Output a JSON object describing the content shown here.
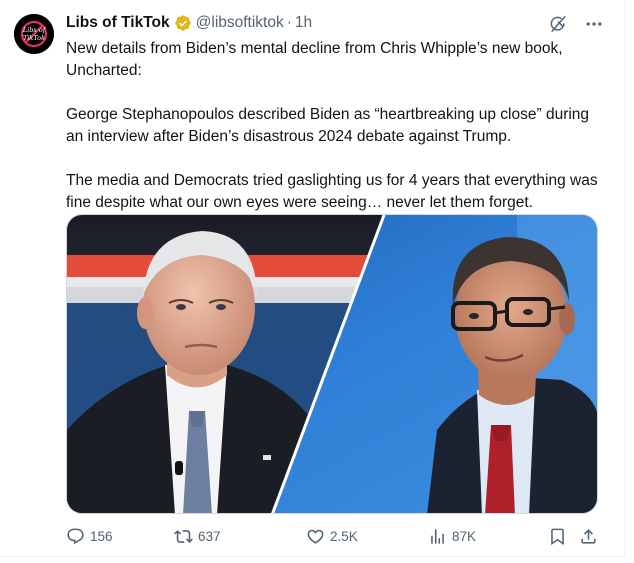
{
  "author": {
    "display_name": "Libs of TikTok",
    "handle": "@libsoftiktok",
    "separator": "·",
    "time": "1h",
    "avatar_text_top": "Libs of",
    "avatar_text_bottom": "TikTok"
  },
  "tweet": {
    "paragraphs": [
      "New details from Biden’s mental decline from Chris Whipple’s new book, Uncharted:",
      "George Stephanopoulos described Biden as “heartbreaking up close” during an interview after Biden’s disastrous 2024 debate against Trump.",
      "The media and Democrats tried gaslighting us for 4 years that everything was fine despite what our own eyes were seeing… never let them forget."
    ]
  },
  "actions": {
    "replies": "156",
    "reposts": "637",
    "likes": "2.5K",
    "views": "87K"
  },
  "colors": {
    "text": "#0f1419",
    "secondary": "#536471",
    "verified_gold": "#e2b719",
    "border": "#cfd9de"
  }
}
